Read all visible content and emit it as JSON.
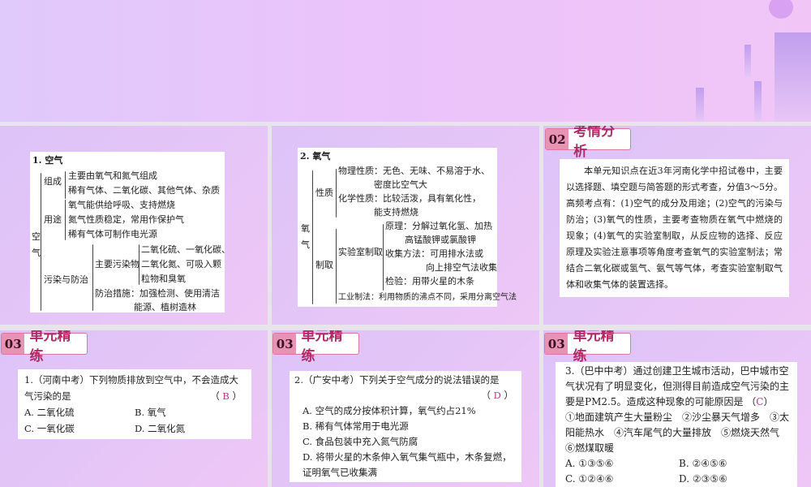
{
  "panel1": {
    "title": "1. 空气",
    "root": "空气",
    "groups": [
      {
        "label": "组成",
        "items": [
          "主要由氧气和氮气组成",
          "稀有气体、二氧化碳、其他气体、杂质"
        ]
      },
      {
        "label": "用途",
        "items": [
          "氧气能供给呼吸、支持燃烧",
          "氮气性质稳定，常用作保护气",
          "稀有气体可制作电光源"
        ]
      },
      {
        "label": "污染与防治",
        "sub_label": "主要污染物",
        "sub_items": [
          "二氧化硫、一氧化碳、",
          "二氧化氮、可吸入颗",
          "粒物和臭氧"
        ],
        "measures": [
          "防治措施：加强检测、使用清洁",
          "能源、植树造林"
        ]
      }
    ]
  },
  "panel2": {
    "title": "2. 氧气",
    "root": "氧气",
    "prop_label": "性质",
    "props": [
      "物理性质：无色、无味、不易溶于水、",
      "密度比空气大",
      "化学性质：比较活泼，具有氧化性，",
      "能支持燃烧"
    ],
    "make_label": "制取",
    "lab_label": "实验室制取",
    "lab": [
      "原理：分解过氧化氢、加热",
      "高锰酸钾或氯酸钾",
      "收集方法：可用排水法或",
      "向上排空气法收集",
      "检验：用带火星的木条"
    ],
    "industry": "工业制法：利用物质的沸点不同，采用分离空气法"
  },
  "panel3": {
    "badge_num": "02",
    "badge_title": "考情分析",
    "text": "本单元知识点在近3年河南化学中招试卷中，主要以选择题、填空题与简答题的形式考查，分值3～5分。高频考点有：(1)空气的成分及用途；(2)空气的污染与防治；(3)氧气的性质，主要考查物质在氧气中燃烧的现象；(4)氧气的实验室制取，从反应物的选择、反应原理及实验注意事项等角度考查氧气的实验室制法；常结合二氧化碳或氢气、氨气等气体，考查实验室制取气体和收集气体的装置选择。"
  },
  "section_badge": {
    "num": "03",
    "title": "单元精练"
  },
  "q1": {
    "stem": "1.（河南中考）下列物质排放到空气中，不会造成大气污染的是",
    "answer": "B",
    "options": [
      "A. 二氧化硫",
      "B. 氧气",
      "C. 一氧化碳",
      "D. 二氧化氮"
    ]
  },
  "q2": {
    "stem": "2.（广安中考）下列关于空气成分的说法错误的是",
    "answer": "D",
    "options": [
      "A. 空气的成分按体积计算，氧气约占21%",
      "B. 稀有气体常用于电光源",
      "C. 食品包装中充入氮气防腐",
      "D. 将带火星的木条伸入氧气集气瓶中，木条复燃，证明氧气已收集满"
    ]
  },
  "q3": {
    "stem": "3.（巴中中考）通过创建卫生城市活动，巴中城市空气状况有了明显变化，但测得目前造成空气污染的主要是PM2.5。造成这种现象的可能原因是",
    "answer": "C",
    "items": "①地面建筑产生大量粉尘　②沙尘暴天气增多　③太阳能热水　④汽车尾气的大量排放　⑤燃烧天然气　⑥燃煤取暖",
    "options": [
      "A. ①③⑤⑥",
      "B. ②④⑤⑥",
      "C. ①②④⑥",
      "D. ②③⑤⑥"
    ]
  }
}
